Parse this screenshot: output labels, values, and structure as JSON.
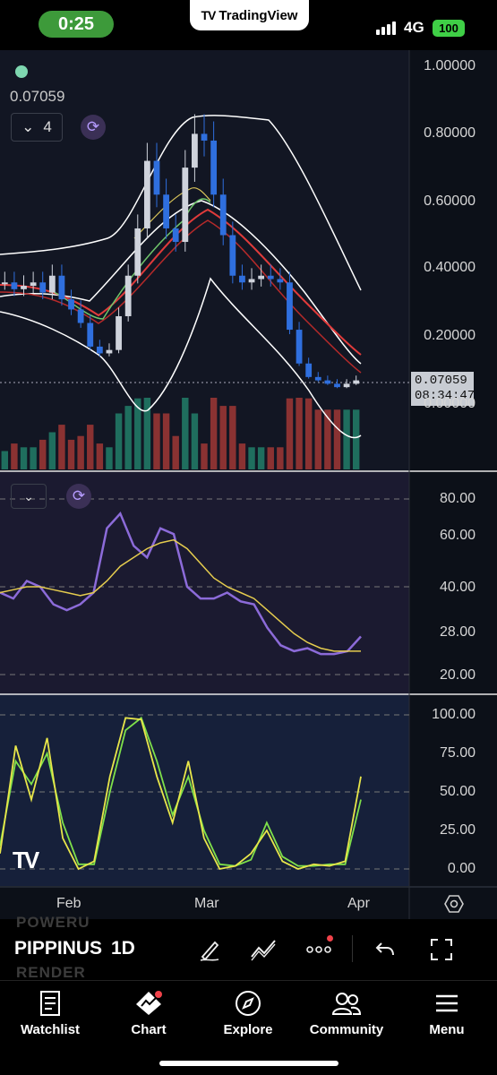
{
  "status_bar": {
    "time": "0:25",
    "app_name": "TradingView",
    "network": "4G",
    "battery": "100"
  },
  "chart": {
    "last_price": "0.07059",
    "indicator_count": "4",
    "price_tag": {
      "price": "0.07059",
      "countdown": "08:34:47"
    },
    "price_axis": [
      "1.00000",
      "0.80000",
      "0.60000",
      "0.40000",
      "0.20000",
      "0.00000"
    ],
    "rsi_axis": [
      "80.00",
      "60.00",
      "40.00",
      "28.00",
      "20.00"
    ],
    "stoch_axis": [
      "100.00",
      "75.00",
      "50.00",
      "25.00",
      "0.00"
    ],
    "time_axis": [
      "Feb",
      "Mar",
      "Apr"
    ],
    "watermark": "TV"
  },
  "chart_data": [
    {
      "type": "line",
      "title": "",
      "series": [
        {
          "values": [
            0.36,
            0.34,
            0.35,
            0.36,
            0.33,
            0.38,
            0.31,
            0.28,
            0.24,
            0.17,
            0.15,
            0.16,
            0.26,
            0.38,
            0.52,
            0.72,
            0.62,
            0.52,
            0.48,
            0.7,
            0.8,
            0.78,
            0.62,
            0.5,
            0.38,
            0.36,
            0.37,
            0.38,
            0.37,
            0.36,
            0.22,
            0.12,
            0.08,
            0.07,
            0.06,
            0.05,
            0.06,
            0.07
          ]
        }
      ],
      "ylim": [
        0,
        1
      ]
    },
    {
      "type": "line",
      "title": "",
      "series": [
        {
          "values": [
            48,
            46,
            52,
            50,
            44,
            42,
            44,
            48,
            70,
            75,
            64,
            60,
            70,
            68,
            50,
            46,
            46,
            48,
            45,
            44,
            36,
            30,
            28,
            29,
            27,
            27,
            28,
            33
          ]
        },
        {
          "values": [
            48,
            49,
            50,
            50,
            49,
            48,
            47,
            48,
            52,
            57,
            60,
            63,
            65,
            66,
            63,
            58,
            53,
            50,
            48,
            46,
            42,
            38,
            34,
            31,
            29,
            28,
            28,
            28
          ]
        }
      ],
      "ylim": [
        20,
        80
      ]
    },
    {
      "type": "line",
      "title": "",
      "series": [
        {
          "values": [
            10,
            80,
            45,
            85,
            20,
            0,
            5,
            60,
            98,
            97,
            60,
            30,
            70,
            20,
            0,
            2,
            10,
            25,
            5,
            0,
            3,
            2,
            5,
            60
          ]
        },
        {
          "values": [
            15,
            70,
            55,
            75,
            30,
            3,
            3,
            50,
            90,
            98,
            70,
            35,
            60,
            25,
            3,
            2,
            6,
            30,
            8,
            2,
            2,
            3,
            3,
            45
          ]
        }
      ],
      "ylim": [
        0,
        100
      ]
    }
  ],
  "toolbar": {
    "ghost_top": "POWERU",
    "symbol": "PIPPINUSDT",
    "interval": "1D",
    "ghost_bottom": "RENDER"
  },
  "nav": {
    "watchlist": "Watchlist",
    "chart": "Chart",
    "explore": "Explore",
    "community": "Community",
    "menu": "Menu"
  },
  "colors": {
    "bull_candle": "#cfd3dc",
    "bear_candle": "#2f6fde",
    "rsi_line": "#8c6bd9",
    "rsi_ma": "#e5cc4e",
    "stoch_k": "#e8e64a",
    "stoch_d": "#7ee04a",
    "accent_green": "#3d9a3a"
  }
}
